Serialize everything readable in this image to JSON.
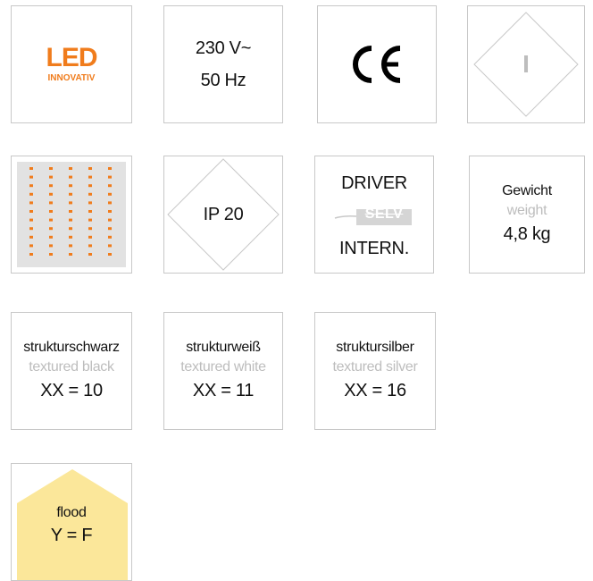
{
  "led_logo": {
    "main": "LED",
    "sub": "INNOVATIV",
    "color": "#f07c1c"
  },
  "voltage": {
    "line1": "230 V~",
    "line2": "50 Hz"
  },
  "ce_mark": {
    "text": "CE"
  },
  "protection_class": {
    "symbol": "I"
  },
  "led_grid": {
    "color": "#f07c1c",
    "background": "#e2e2e2",
    "columns": 5
  },
  "ip_rating": {
    "label": "IP 20"
  },
  "driver": {
    "line1": "DRIVER",
    "selv": "SELV",
    "line2": "INTERN."
  },
  "weight": {
    "label_de": "Gewicht",
    "label_en": "weight",
    "value": "4,8 kg"
  },
  "finishes": [
    {
      "name_de": "strukturschwarz",
      "name_en": "textured black",
      "code": "XX = 10"
    },
    {
      "name_de": "strukturweiß",
      "name_en": "textured white",
      "code": "XX = 11"
    },
    {
      "name_de": "struktursilber",
      "name_en": "textured silver",
      "code": "XX = 16"
    }
  ],
  "beam": {
    "label": "flood",
    "code": "Y = F",
    "color": "#fbe79a"
  }
}
